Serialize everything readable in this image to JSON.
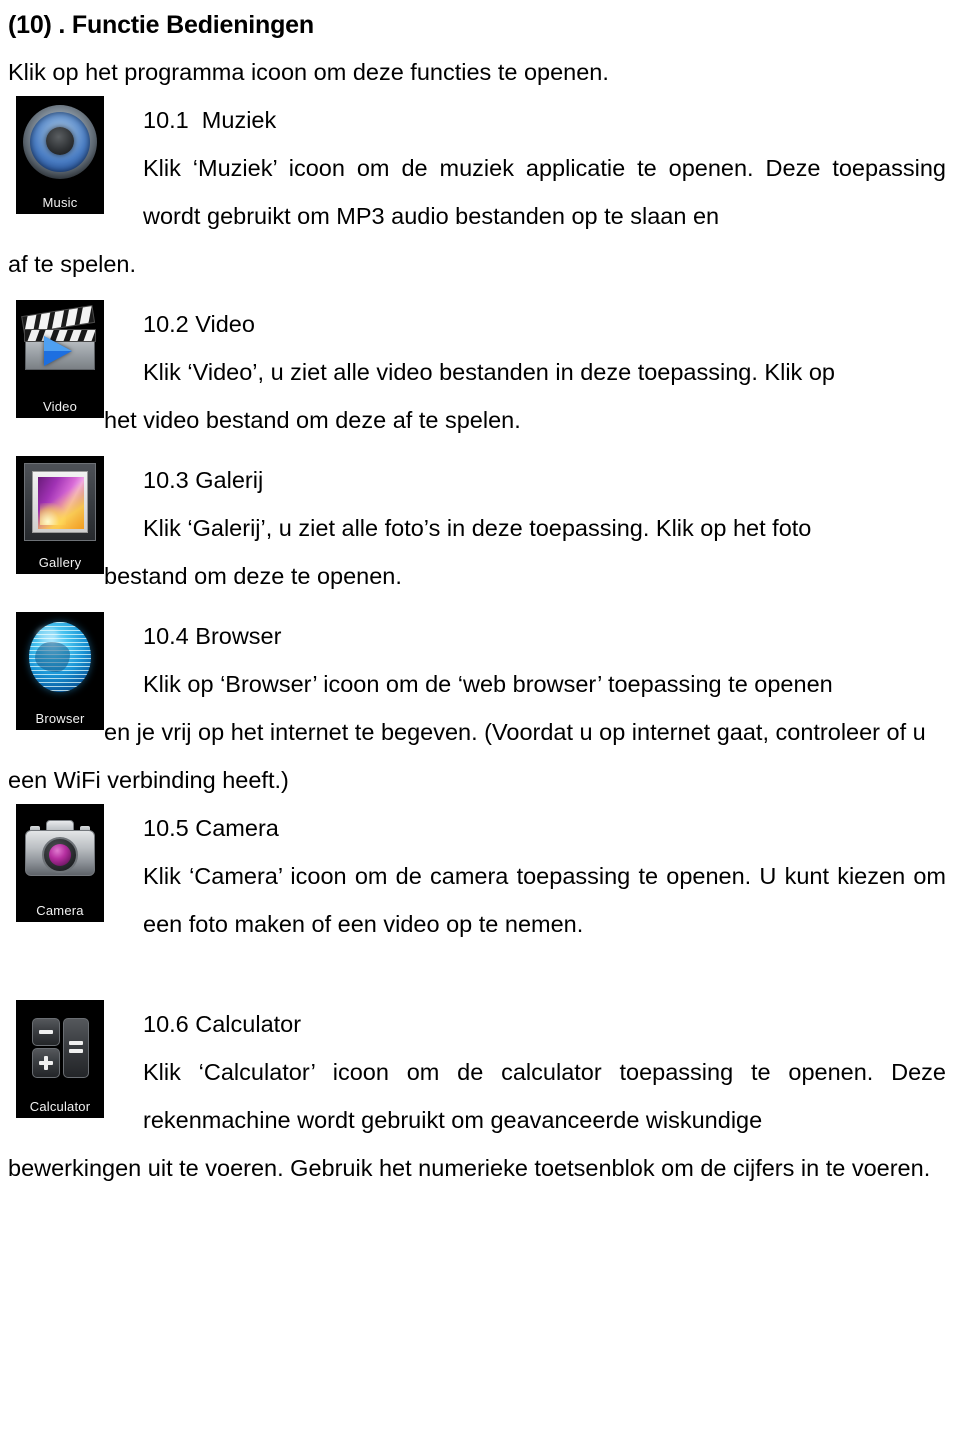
{
  "document": {
    "title": "(10) . Functie Bedieningen",
    "lead": "Klik op het programma icoon om deze functies te openen."
  },
  "sections": [
    {
      "number": "10.1",
      "heading": "10.1  Muziek",
      "icon_caption": "Music",
      "icon_name": "music-app-icon",
      "first_line": "Klik ‘Muziek’ icoon om de muziek applicatie te openen. Deze toepassing wordt gebruikt om MP3 audio bestanden op te slaan en",
      "rest": "af te spelen."
    },
    {
      "number": "10.2",
      "heading": "10.2 Video",
      "icon_caption": "Video",
      "icon_name": "video-app-icon",
      "first_line": "Klik ‘Video’, u ziet alle video bestanden in deze toepassing. Klik op",
      "rest": "het video bestand om deze af te spelen."
    },
    {
      "number": "10.3",
      "heading": "10.3 Galerij",
      "icon_caption": "Gallery",
      "icon_name": "gallery-app-icon",
      "first_line": "Klik ‘Galerij’, u ziet alle foto’s in deze toepassing. Klik op het foto",
      "rest": "bestand om deze te openen."
    },
    {
      "number": "10.4",
      "heading": "10.4 Browser",
      "icon_caption": "Browser",
      "icon_name": "browser-app-icon",
      "first_line": "Klik op ‘Browser’ icoon om de ‘web browser’ toepassing te openen",
      "rest": "en je vrij op het internet te begeven. (Voordat u op internet gaat, controleer of u een WiFi verbinding heeft.)"
    },
    {
      "number": "10.5",
      "heading": "10.5 Camera",
      "icon_caption": "Camera",
      "icon_name": "camera-app-icon",
      "first_line": "Klik ‘Camera’ icoon om de camera toepassing te openen. U kunt kiezen om een foto maken of een video op te nemen.",
      "rest": ""
    },
    {
      "number": "10.6",
      "heading": "10.6 Calculator",
      "icon_caption": "Calculator",
      "icon_name": "calculator-app-icon",
      "first_line": "Klik ‘Calculator’ icoon om de calculator toepassing te openen. Deze rekenmachine wordt gebruikt om geavanceerde wiskundige",
      "rest": "bewerkingen uit te voeren. Gebruik het numerieke toetsenblok om de cijfers in te voeren."
    }
  ],
  "colors": {
    "page_background": "#ffffff",
    "text": "#000000",
    "icon_background": "#000000",
    "music_cone": "#4b7ec4",
    "video_play": "#1d6fe0",
    "gallery_photo": "#b954c8",
    "browser_globe": "#1a93d4",
    "camera_lens": "#b62fa0",
    "calculator_key": "#3a3d41"
  }
}
